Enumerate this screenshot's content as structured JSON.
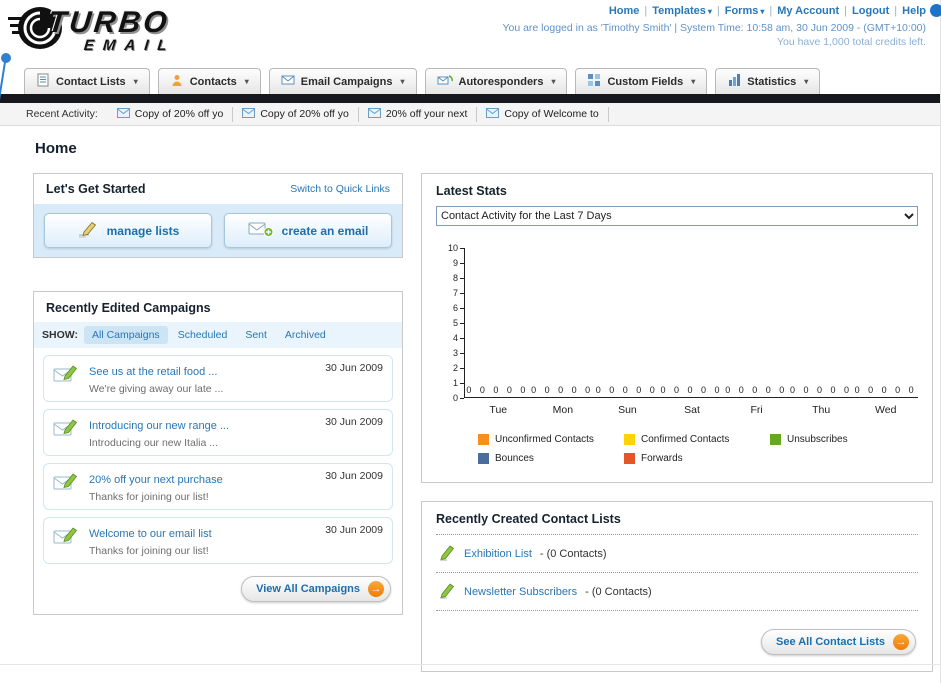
{
  "colors": {
    "link_blue": "#2a77b5",
    "dark_bar": "#17181d",
    "panel_blue": "#d9ebf8",
    "arrow_orange": "#ee7c00"
  },
  "header": {
    "logo_line1": "TURBO",
    "logo_line2": "EMAIL",
    "nav": [
      {
        "label": "Home"
      },
      {
        "label": "Templates"
      },
      {
        "label": "Forms"
      },
      {
        "label": "My Account"
      },
      {
        "label": "Logout"
      },
      {
        "label": "Help"
      }
    ],
    "login_info": "You are logged in as 'Timothy Smith' | System Time: 10:58 am, 30 Jun 2009 - (GMT+10:00)",
    "credits_info": "You have 1,000 total credits left."
  },
  "tabs": [
    {
      "label": "Contact Lists"
    },
    {
      "label": "Contacts"
    },
    {
      "label": "Email Campaigns"
    },
    {
      "label": "Autoresponders"
    },
    {
      "label": "Custom Fields"
    },
    {
      "label": "Statistics"
    }
  ],
  "recent_activity": {
    "label": "Recent Activity:",
    "items": [
      "Copy of 20% off yo",
      "Copy of 20% off yo",
      "20% off your next",
      "Copy of Welcome to"
    ]
  },
  "page_title": "Home",
  "get_started": {
    "title": "Let's Get Started",
    "switch_link": "Switch to Quick Links",
    "buttons": [
      {
        "label": "manage lists"
      },
      {
        "label": "create an email"
      }
    ]
  },
  "campaigns": {
    "title": "Recently Edited Campaigns",
    "show_label": "SHOW:",
    "filters": [
      "All Campaigns",
      "Scheduled",
      "Sent",
      "Archived"
    ],
    "items": [
      {
        "title": "See us at the retail food ...",
        "subtitle": "We're giving away our late ...",
        "date": "30 Jun 2009"
      },
      {
        "title": "Introducing our new range ...",
        "subtitle": "Introducing our new Italia ...",
        "date": "30 Jun 2009"
      },
      {
        "title": "20% off your next purchase",
        "subtitle": "Thanks for joining our list!",
        "date": "30 Jun 2009"
      },
      {
        "title": "Welcome to our email list",
        "subtitle": "Thanks for joining our list!",
        "date": "30 Jun 2009"
      }
    ],
    "view_all_label": "View All Campaigns"
  },
  "stats": {
    "title": "Latest Stats",
    "dropdown_value": "Contact Activity for the Last 7 Days",
    "chart_data": {
      "type": "bar",
      "categories": [
        "Tue",
        "Mon",
        "Sun",
        "Sat",
        "Fri",
        "Thu",
        "Wed"
      ],
      "series": [
        {
          "name": "Unconfirmed Contacts",
          "color": "#f78f1e",
          "values": [
            0,
            0,
            0,
            0,
            0,
            0,
            0
          ]
        },
        {
          "name": "Confirmed Contacts",
          "color": "#ffd200",
          "values": [
            0,
            0,
            0,
            0,
            0,
            0,
            0
          ]
        },
        {
          "name": "Unsubscribes",
          "color": "#66a822",
          "values": [
            0,
            0,
            0,
            0,
            0,
            0,
            0
          ]
        },
        {
          "name": "Bounces",
          "color": "#4a6d9e",
          "values": [
            0,
            0,
            0,
            0,
            0,
            0,
            0
          ]
        },
        {
          "name": "Forwards",
          "color": "#e65525",
          "values": [
            0,
            0,
            0,
            0,
            0,
            0,
            0
          ]
        }
      ],
      "ylim": [
        0,
        10
      ],
      "yticks": [
        0,
        1,
        2,
        3,
        4,
        5,
        6,
        7,
        8,
        9,
        10
      ],
      "legend_position": "bottom",
      "grid": false
    }
  },
  "contact_lists": {
    "title": "Recently Created Contact Lists",
    "items": [
      {
        "name": "Exhibition List",
        "detail": "- (0 Contacts)"
      },
      {
        "name": "Newsletter Subscribers",
        "detail": "- (0 Contacts)"
      }
    ],
    "see_all_label": "See All Contact Lists"
  }
}
